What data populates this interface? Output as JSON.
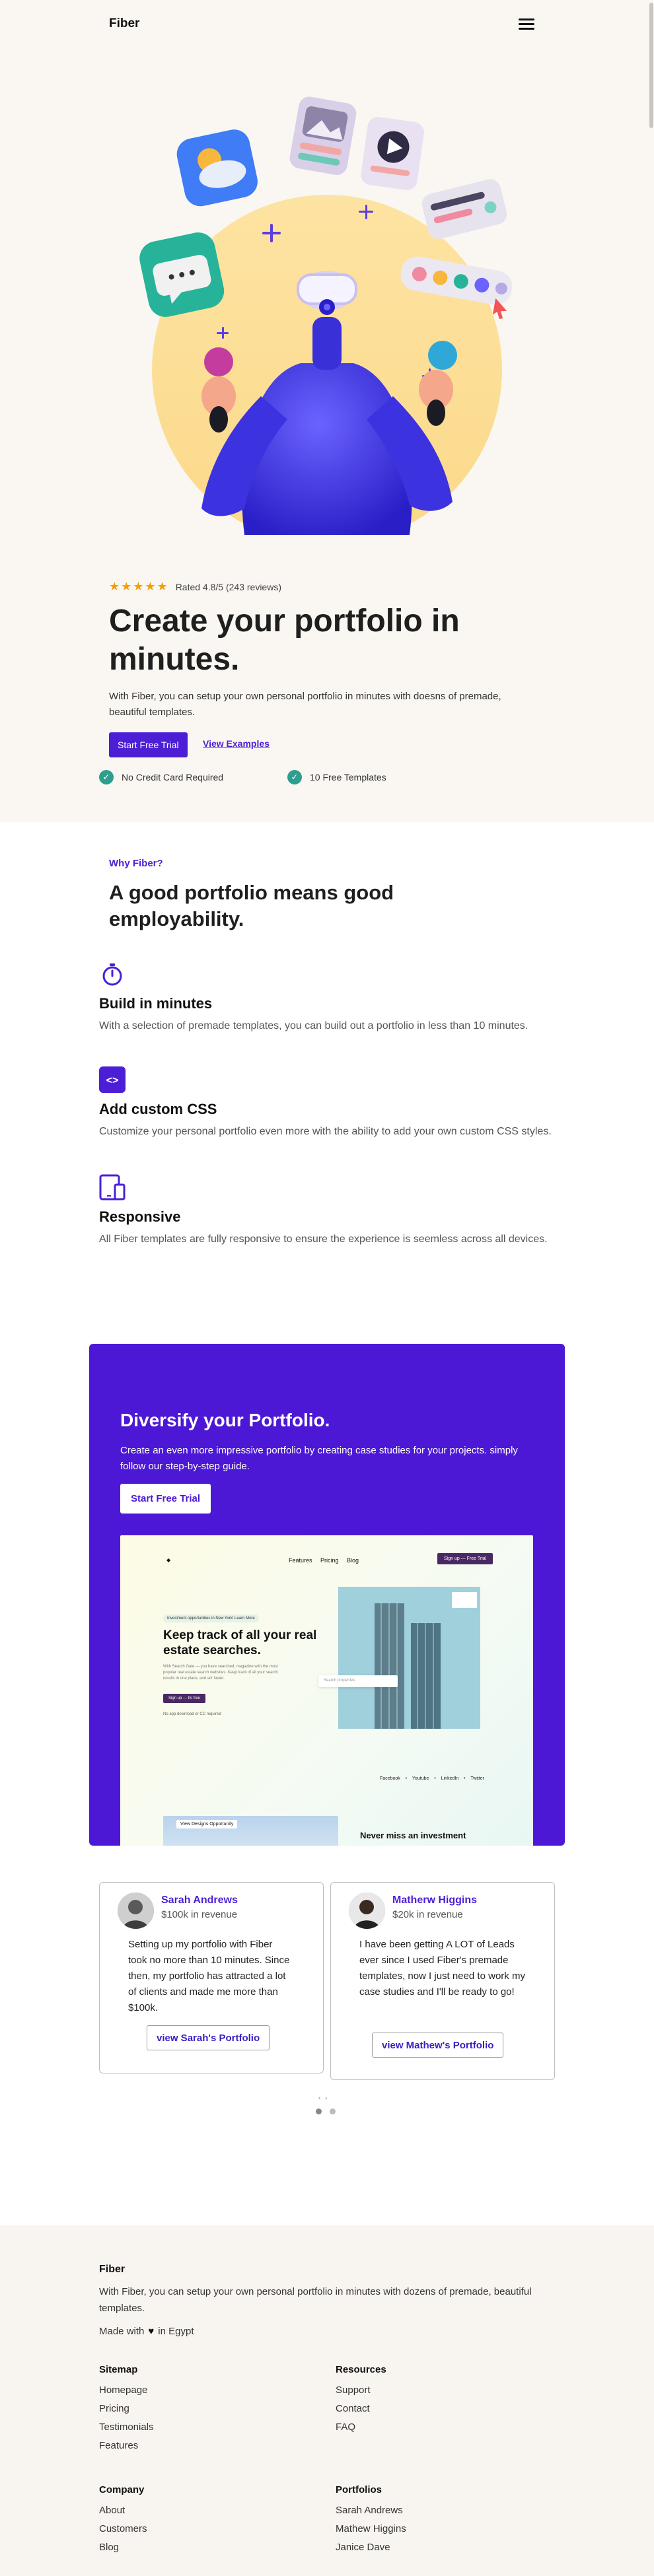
{
  "header": {
    "brand": "Fiber",
    "menu_icon": "hamburger-icon"
  },
  "hero": {
    "rating_text": "Rated 4.8/5 (243 reviews)",
    "stars": "★★★★★",
    "title": "Create your portfolio in minutes.",
    "lead": "With Fiber, you can setup your own personal portfolio in minutes with doesns of premade, beautiful templates.",
    "cta_primary": "Start Free Trial",
    "cta_secondary": "View Examples",
    "checks": [
      "No Credit Card Required",
      "10 Free Templates"
    ]
  },
  "why": {
    "eyebrow": "Why Fiber?",
    "title": "A good portfolio means good employability.",
    "features": [
      {
        "icon": "stopwatch-icon",
        "title": "Build in minutes",
        "text": "With a selection of premade templates, you can build out a portfolio in less than 10 minutes."
      },
      {
        "icon": "code-icon",
        "title": "Add custom CSS",
        "text": "Customize your personal portfolio even more with the ability to add your own custom CSS styles."
      },
      {
        "icon": "devices-icon",
        "title": "Responsive",
        "text": "All Fiber templates are fully responsive to ensure the experience is seemless across all devices."
      }
    ]
  },
  "diversify": {
    "title": "Diversify your Portfolio.",
    "text": "Create an even more impressive portfolio by creating case studies for your projects. simply follow our step-by-step guide.",
    "cta": "Start Free Trial",
    "mockup": {
      "nav_links": "Features Pricing Blog",
      "sign_up": "Sign up — Free Trial",
      "pill": "Investment opportunities in New York!   Learn More",
      "headline": "Keep track of all your real estate searches.",
      "subtext": "With Search Gate — you have searched, magazine with the most popular real estate search websites. Keep track of all your search results in one place, and act faster.",
      "button": "Sign up — Its free",
      "note": "No app download or CC required",
      "search_placeholder": "Search properties",
      "social": "Facebook • Youtube • LinkedIn • Twitter",
      "image_badge": "View Designs Opportunity",
      "never": "Never miss an investment"
    }
  },
  "testimonials": [
    {
      "name": "Sarah Andrews",
      "revenue": "$100k in revenue",
      "quote": "Setting up my portfolio with Fiber took no more than 10 minutes. Since then, my portfolio has attracted a lot of clients and made me more than $100k.",
      "button": "view Sarah's Portfolio"
    },
    {
      "name": "Matherw Higgins",
      "revenue": "$20k in revenue",
      "quote": "I have been getting A LOT of Leads ever since I used Fiber's premade templates, now I just need to work my case studies and I'll be ready to go!",
      "button": "view Mathew's Portfolio"
    }
  ],
  "carousel": {
    "arrows": "‹ ›"
  },
  "footer": {
    "brand": "Fiber",
    "description": "With Fiber, you can setup your own personal portfolio in minutes with dozens of premade, beautiful templates.",
    "made_prefix": "Made with",
    "made_suffix": "in Egypt",
    "columns": [
      {
        "title": "Sitemap",
        "links": [
          "Homepage",
          "Pricing",
          "Testimonials",
          "Features"
        ]
      },
      {
        "title": "Resources",
        "links": [
          "Support",
          "Contact",
          "FAQ"
        ]
      },
      {
        "title": "Company",
        "links": [
          "About",
          "Customers",
          "Blog"
        ]
      },
      {
        "title": "Portfolios",
        "links": [
          "Sarah Andrews",
          "Mathew Higgins",
          "Janice Dave"
        ]
      }
    ]
  },
  "colors": {
    "accent": "#4c1fd6",
    "panel": "#4c18d6",
    "hero_bg": "#faf7f2",
    "check": "#2f9e8f",
    "star": "#f59e0b"
  }
}
